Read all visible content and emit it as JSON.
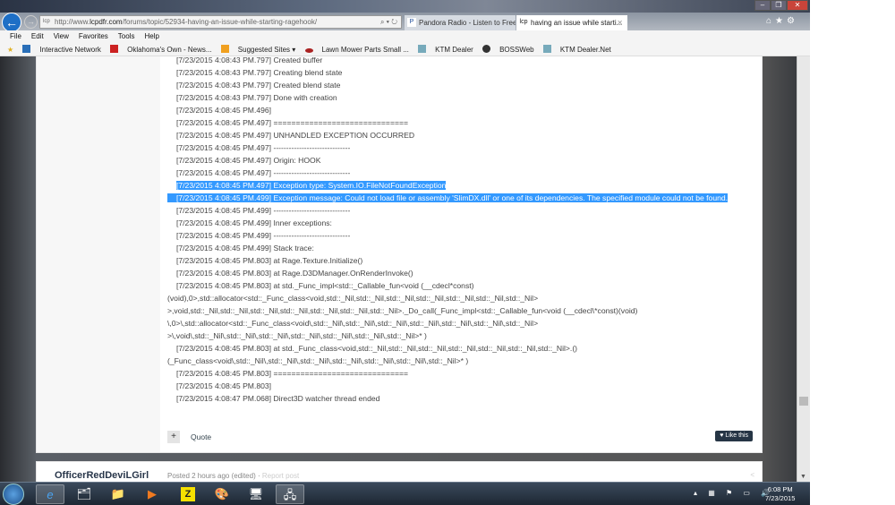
{
  "browser": {
    "url_prefix": "http://www.",
    "url_domain": "lcpdfr.com",
    "url_path": "/forums/topic/52934-having-an-issue-while-starting-ragehook/",
    "tabs": [
      {
        "label": "Pandora Radio - Listen to Free ...",
        "icon": "P"
      },
      {
        "label": "having an issue while starti...",
        "icon": "lcp"
      }
    ],
    "menu": [
      "File",
      "Edit",
      "View",
      "Favorites",
      "Tools",
      "Help"
    ],
    "favorites": [
      "Interactive Network",
      "Oklahoma's Own - News...",
      "Suggested Sites ▾",
      "Lawn Mower Parts  Small ...",
      "KTM Dealer",
      "BOSSWeb",
      "KTM Dealer.Net"
    ]
  },
  "post": {
    "lines": [
      {
        "t": "[7/23/2015 4:08:43 PM.797] Created buffer",
        "c": false,
        "s": false
      },
      {
        "t": "[7/23/2015 4:08:43 PM.797] Creating blend state",
        "c": false,
        "s": false
      },
      {
        "t": "[7/23/2015 4:08:43 PM.797] Created blend state",
        "c": false,
        "s": false
      },
      {
        "t": "[7/23/2015 4:08:43 PM.797] Done with creation",
        "c": false,
        "s": false
      },
      {
        "t": "[7/23/2015 4:08:45 PM.496]",
        "c": false,
        "s": false
      },
      {
        "t": "[7/23/2015 4:08:45 PM.497] ==============================",
        "c": false,
        "s": false
      },
      {
        "t": "[7/23/2015 4:08:45 PM.497] UNHANDLED EXCEPTION OCCURRED",
        "c": false,
        "s": false
      },
      {
        "t": "[7/23/2015 4:08:45 PM.497] ------------------------------",
        "c": false,
        "s": false
      },
      {
        "t": "[7/23/2015 4:08:45 PM.497] Origin: HOOK",
        "c": false,
        "s": false
      },
      {
        "t": "[7/23/2015 4:08:45 PM.497] ------------------------------",
        "c": false,
        "s": false
      },
      {
        "t": "[7/23/2015 4:08:45 PM.497] Exception type: System.IO.FileNotFoundException",
        "c": false,
        "s": true
      },
      {
        "t": "[7/23/2015 4:08:45 PM.499] Exception message: Could not load file or assembly 'SlimDX.dll' or one of its dependencies. The specified module could not be found.",
        "c": false,
        "s": true
      },
      {
        "t": "[7/23/2015 4:08:45 PM.499] ------------------------------",
        "c": false,
        "s": false
      },
      {
        "t": "[7/23/2015 4:08:45 PM.499] Inner exceptions:",
        "c": false,
        "s": false
      },
      {
        "t": "[7/23/2015 4:08:45 PM.499] ------------------------------",
        "c": false,
        "s": false
      },
      {
        "t": "[7/23/2015 4:08:45 PM.499] Stack trace:",
        "c": false,
        "s": false
      },
      {
        "t": "[7/23/2015 4:08:45 PM.803] at Rage.Texture.Initialize()",
        "c": false,
        "s": false
      },
      {
        "t": "[7/23/2015 4:08:45 PM.803] at Rage.D3DManager.OnRenderInvoke()",
        "c": false,
        "s": false
      },
      {
        "t": "[7/23/2015 4:08:45 PM.803] at std._Func_impl<std::_Callable_fun<void (__cdecl*const)",
        "c": false,
        "s": false
      },
      {
        "t": "(void),0>,std::allocator<std::_Func_class<void,std::_Nil,std::_Nil,std::_Nil,std::_Nil,std::_Nil,std::_Nil,std::_Nil>",
        "c": true,
        "s": false
      },
      {
        "t": ">,void,std::_Nil,std::_Nil,std::_Nil,std::_Nil,std::_Nil,std::_Nil,std::_Nil>._Do_call(_Func_impl<std::_Callable_fun<void (__cdecl\\*const)(void)",
        "c": true,
        "s": false
      },
      {
        "t": "\\,0>\\,std::allocator<std::_Func_class<void\\,std::_Nil\\,std::_Nil\\,std::_Nil\\,std::_Nil\\,std::_Nil\\,std::_Nil\\,std::_Nil>",
        "c": true,
        "s": false
      },
      {
        "t": ">\\,void\\,std::_Nil\\,std::_Nil\\,std::_Nil\\,std::_Nil\\,std::_Nil\\,std::_Nil\\,std::_Nil>* )",
        "c": true,
        "s": false
      },
      {
        "t": "[7/23/2015 4:08:45 PM.803] at std._Func_class<void,std::_Nil,std::_Nil,std::_Nil,std::_Nil,std::_Nil,std::_Nil,std::_Nil>.()",
        "c": false,
        "s": false
      },
      {
        "t": "(_Func_class<void\\,std::_Nil\\,std::_Nil\\,std::_Nil\\,std::_Nil\\,std::_Nil\\,std::_Nil\\,std::_Nil>* )",
        "c": true,
        "s": false
      },
      {
        "t": "[7/23/2015 4:08:45 PM.803] ==============================",
        "c": false,
        "s": false
      },
      {
        "t": "[7/23/2015 4:08:45 PM.803]",
        "c": false,
        "s": false
      },
      {
        "t": "[7/23/2015 4:08:47 PM.068] Direct3D watcher thread ended",
        "c": false,
        "s": false
      }
    ],
    "quote_label": "Quote",
    "like_label": "Like this"
  },
  "next_post": {
    "author": "OfficerRedDeviLGirl",
    "posted": "Posted 2 hours ago (edited)",
    "report": "Report post"
  },
  "taskbar": {
    "time": "6:08 PM",
    "date": "7/23/2015"
  }
}
